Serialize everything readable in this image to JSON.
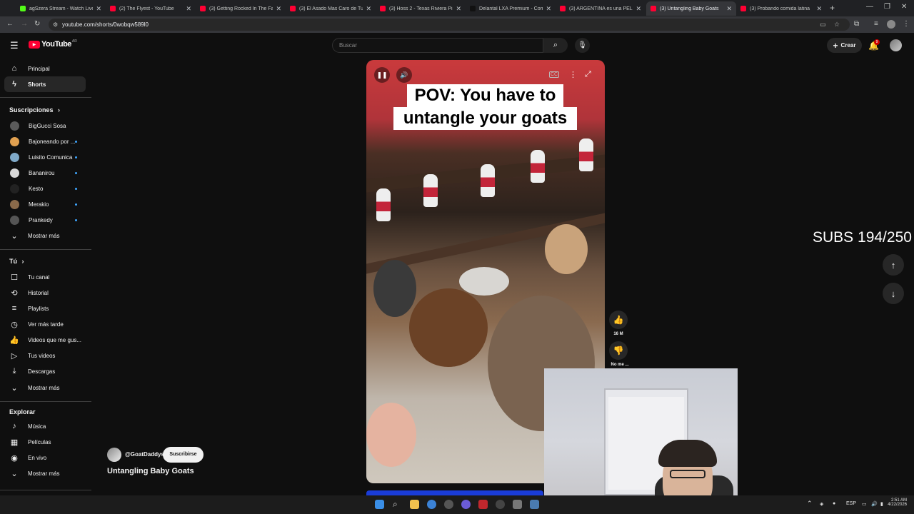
{
  "browser": {
    "tabs": [
      {
        "title": "agSzera Stream - Watch Live",
        "active": false
      },
      {
        "title": "(2) The Flyest - YouTube",
        "active": false
      },
      {
        "title": "(3) Getting Rocked In The Face",
        "active": false
      },
      {
        "title": "(3) El Asado Mas Caro de Tu",
        "active": false
      },
      {
        "title": "(3) Hoss 2 - Texas Riviera Pist",
        "active": false
      },
      {
        "title": "Delantal LXA Premium - Com",
        "active": false
      },
      {
        "title": "(3) ARGENTINA es una PELIC",
        "active": false
      },
      {
        "title": "(3) Untangling Baby Goats",
        "active": true
      },
      {
        "title": "(3) Probando comida latina",
        "active": false
      }
    ],
    "new_tab": "+",
    "url": "youtube.com/shorts/0wobqw589l0"
  },
  "youtube": {
    "logo_text": "YouTube",
    "logo_region": "AR",
    "search_placeholder": "Buscar",
    "create_label": "Crear",
    "notification_count": "9"
  },
  "sidebar": {
    "main": [
      {
        "label": "Principal",
        "icon": "home-icon"
      },
      {
        "label": "Shorts",
        "icon": "shorts-icon",
        "active": true
      }
    ],
    "subscriptions_heading": "Suscripciones",
    "subscriptions": [
      {
        "label": "BigGucci Sosa",
        "color": "#5a5a5a",
        "dot": false
      },
      {
        "label": "Bajoneando por ...",
        "color": "#e0a050",
        "dot": true
      },
      {
        "label": "Luisito Comunica",
        "color": "#7fa9c8",
        "dot": true
      },
      {
        "label": "Bananirou",
        "color": "#d8d8d8",
        "dot": true
      },
      {
        "label": "Kesto",
        "color": "#222222",
        "dot": true
      },
      {
        "label": "Merakio",
        "color": "#8a6a4a",
        "dot": true
      },
      {
        "label": "Prankedy",
        "color": "#555555",
        "dot": true
      }
    ],
    "show_more": "Mostrar más",
    "you_heading": "Tú",
    "you_items": [
      {
        "label": "Tu canal",
        "icon": "channel-icon"
      },
      {
        "label": "Historial",
        "icon": "history-icon"
      },
      {
        "label": "Playlists",
        "icon": "playlists-icon"
      },
      {
        "label": "Ver más tarde",
        "icon": "watch-later-icon"
      },
      {
        "label": "Videos que me gus...",
        "icon": "liked-videos-icon"
      },
      {
        "label": "Tus videos",
        "icon": "your-videos-icon"
      },
      {
        "label": "Descargas",
        "icon": "downloads-icon"
      }
    ],
    "show_more_2": "Mostrar más",
    "explore_heading": "Explorar",
    "explore_items": [
      {
        "label": "Música",
        "icon": "music-icon"
      },
      {
        "label": "Películas",
        "icon": "movies-icon"
      },
      {
        "label": "En vivo",
        "icon": "live-icon"
      }
    ],
    "show_more_3": "Mostrar más"
  },
  "short": {
    "caption_line1": "POV: You have to",
    "caption_line2": "untangle your goats",
    "channel": "@GoatDaddys",
    "subscribe_label": "Suscribirse",
    "title": "Untangling Baby Goats",
    "likes": "16 M",
    "dislike_label": "No me ..."
  },
  "overlay": {
    "subs_counter": "SUBS 194/250"
  },
  "taskbar": {
    "language": "ESP",
    "time": "2:51 AM",
    "date": "4/22/2026"
  }
}
